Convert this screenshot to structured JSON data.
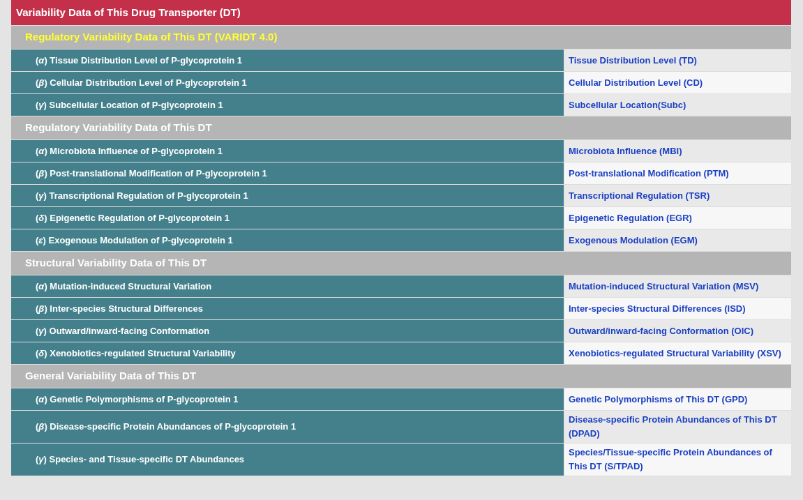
{
  "title": "Variability Data of This Drug Transporter (DT)",
  "sections": [
    {
      "heading": "Regulatory Variability Data of This DT (VARIDT 4.0)",
      "highlighted": true,
      "rows": [
        {
          "label": "(*α*) Tissue Distribution Level of P-glycoprotein 1",
          "link": "Tissue Distribution Level (TD)"
        },
        {
          "label": "(*β*) Cellular Distribution Level of P-glycoprotein 1",
          "link": "Cellular Distribution Level (CD)"
        },
        {
          "label": "(*γ*) Subcellular Location of P-glycoprotein 1",
          "link": "Subcellular Location(Subc)"
        }
      ]
    },
    {
      "heading": "Regulatory Variability Data of This DT",
      "highlighted": false,
      "rows": [
        {
          "label": "(*α*) Microbiota Influence of P-glycoprotein 1",
          "link": "Microbiota Influence (MBI)"
        },
        {
          "label": "(*β*) Post-translational Modification of P-glycoprotein 1",
          "link": "Post-translational Modification (PTM)"
        },
        {
          "label": "(*γ*) Transcriptional Regulation of P-glycoprotein 1",
          "link": "Transcriptional Regulation (TSR)"
        },
        {
          "label": "(*δ*) Epigenetic Regulation of P-glycoprotein 1",
          "link": "Epigenetic Regulation (EGR)"
        },
        {
          "label": "(*ε*) Exogenous Modulation of P-glycoprotein 1",
          "link": "Exogenous Modulation (EGM)"
        }
      ]
    },
    {
      "heading": "Structural Variability Data of This DT",
      "highlighted": false,
      "rows": [
        {
          "label": "(*α*) Mutation-induced Structural Variation",
          "link": "Mutation-induced Structural Variation (MSV)"
        },
        {
          "label": "(*β*) Inter-species Structural Differences",
          "link": "Inter-species Structural Differences (ISD)"
        },
        {
          "label": "(*γ*) Outward/inward-facing Conformation",
          "link": "Outward/inward-facing Conformation (OIC)"
        },
        {
          "label": "(*δ*) Xenobiotics-regulated Structural Variability",
          "link": "Xenobiotics-regulated Structural Variability (XSV)"
        }
      ]
    },
    {
      "heading": "General Variability Data of This DT",
      "highlighted": false,
      "rows": [
        {
          "label": "(*α*) Genetic Polymorphisms of P-glycoprotein 1",
          "link": "Genetic Polymorphisms of This DT (GPD)"
        },
        {
          "label": "(*β*) Disease-specific Protein Abundances of P-glycoprotein 1",
          "link": "Disease-specific Protein Abundances of This DT (DPAD)"
        },
        {
          "label": "(*γ*) Species- and Tissue-specific DT Abundances",
          "link": "Species/Tissue-specific Protein Abundances of This DT (S/TPAD)"
        }
      ]
    }
  ]
}
